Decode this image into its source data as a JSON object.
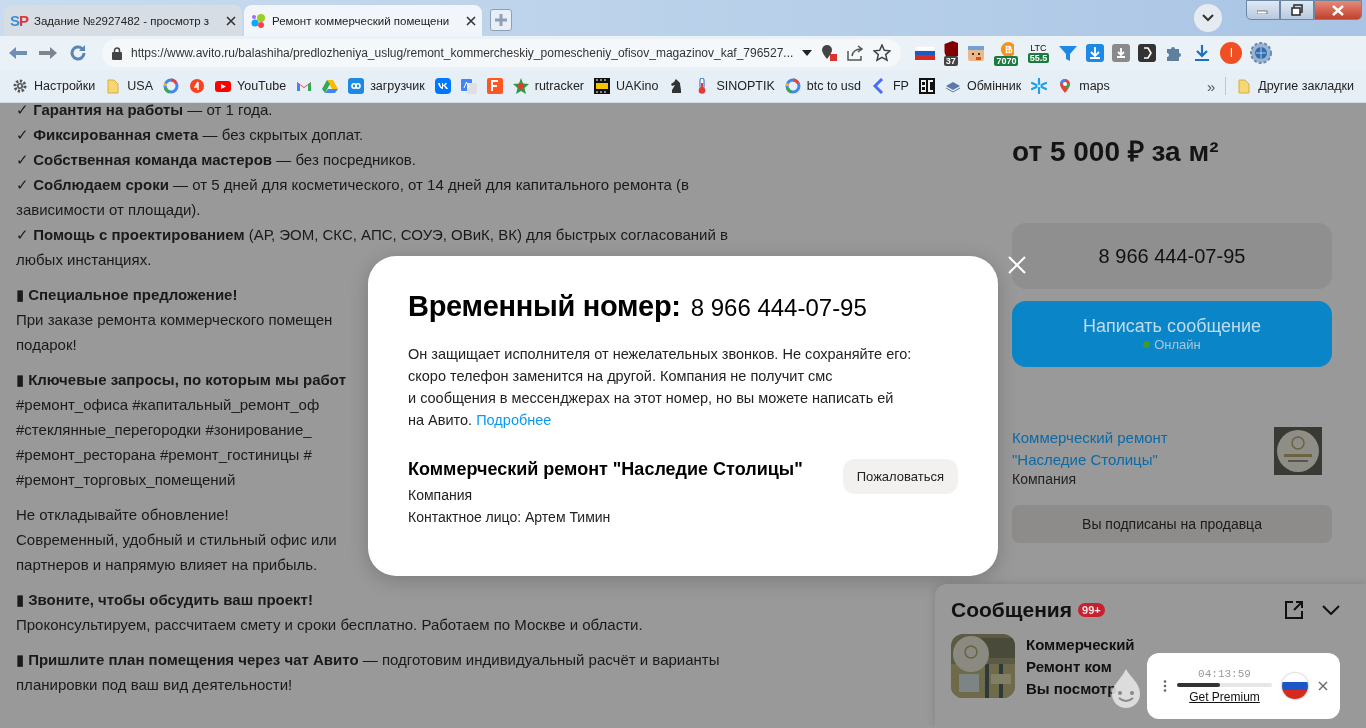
{
  "browser": {
    "tabs": [
      {
        "title": "Задание №2927482 - просмотр з",
        "kind": "sp",
        "icon_text": "SP",
        "selected": false
      },
      {
        "title": "Ремонт коммерческий помещени",
        "kind": "avito",
        "selected": true
      }
    ],
    "url": "https://www.avito.ru/balashiha/predlozheniya_uslug/remont_kommercheskiy_pomescheniy_ofisov_magazinov_kaf_796527...",
    "extensions": [
      {
        "kind": "flag"
      },
      {
        "kind": "shield",
        "badge": "37"
      },
      {
        "kind": "face"
      },
      {
        "kind": "coin",
        "badge": "7070"
      },
      {
        "kind": "ltc",
        "label": "LTC",
        "badge": "55.5"
      },
      {
        "kind": "funnel"
      },
      {
        "kind": "download-blue"
      },
      {
        "kind": "download-grey"
      },
      {
        "kind": "dark"
      },
      {
        "kind": "puzzle"
      },
      {
        "kind": "download"
      },
      {
        "kind": "profile",
        "label": "I"
      },
      {
        "kind": "globe"
      }
    ],
    "bookmarks": [
      {
        "kind": "gear",
        "label": "Настройки"
      },
      {
        "kind": "folder",
        "label": "USA"
      },
      {
        "kind": "google"
      },
      {
        "kind": "yandex"
      },
      {
        "kind": "youtube",
        "label": "YouTube"
      },
      {
        "kind": "gmail"
      },
      {
        "kind": "drive"
      },
      {
        "kind": "infinity",
        "label": "загрузчик"
      },
      {
        "kind": "vk"
      },
      {
        "kind": "translate"
      },
      {
        "kind": "f"
      },
      {
        "kind": "star",
        "label": "rutracker"
      },
      {
        "kind": "film",
        "label": "UAKino"
      },
      {
        "kind": "knight"
      },
      {
        "kind": "thermometer",
        "label": "SINOPTIK"
      },
      {
        "kind": "google",
        "label": "btc to usd"
      },
      {
        "kind": "chevron",
        "label": "FP"
      },
      {
        "kind": "bc"
      },
      {
        "kind": "layers",
        "label": "Обмінник"
      },
      {
        "kind": "asterisk"
      },
      {
        "kind": "pin",
        "label": "maps"
      }
    ],
    "more": "»",
    "other_bookmarks": "Другие закладки"
  },
  "page": {
    "description": [
      [
        "✓ **Гарантия на работы** — от 1 года.",
        "✓ **Фиксированная смета** — без скрытых доплат.",
        "✓ **Собственная команда мастеров** — без посредников.",
        "✓ **Соблюдаем сроки** — от 5 дней для косметического, от 14 дней для капитального ремонта (в",
        "зависимости от площади).",
        "✓ **Помощь с проектированием** (АР, ЭОМ, СКС, АПС, СОУЭ, ОВиК, ВК) для быстрых согласований в",
        "любых инстанциях."
      ],
      [
        "▮ **Специальное предложение!**",
        "При заказе ремонта коммерческого помещен",
        "подарок!"
      ],
      [
        "▮ **Ключевые запросы, по которым мы работ**",
        "#ремонт_офиса #капитальный_ремонт_оф",
        "#стеклянные_перегородки #зонирование_",
        "#ремонт_ресторана #ремонт_гостиницы #",
        "#ремонт_торговых_помещений"
      ],
      [
        "Не откладывайте обновление!",
        "Современный, удобный и стильный офис или",
        "партнеров и напрямую влияет на прибыль."
      ],
      [
        "▮ **Звоните, чтобы обсудить ваш проект!**",
        "Проконсультируем, рассчитаем смету и сроки бесплатно. Работаем по Москве и области."
      ],
      [
        "▮ **Пришлите план помещения через чат Авито** — подготовим индивидуальный расчёт и варианты",
        "планировки под ваш вид деятельности!"
      ]
    ],
    "price": "от 5 000 ₽ за м²",
    "phone_button": "8 966 444-07-95",
    "write_button": {
      "label": "Написать сообщение",
      "status": "Онлайн",
      "online": true
    },
    "seller": {
      "name": "Коммерческий ремонт \"Наследие Столицы\"",
      "type": "Компания"
    },
    "subscribed_button": "Вы подписаны на продавца"
  },
  "modal": {
    "title": "Временный номер:",
    "phone": "8 966 444-07-95",
    "text": "Он защищает исполнителя от нежелательных звонков. Не сохраняйте его:\nскоро телефон заменится на другой. Компания не получит смс\nи сообщения в мессенджерах на этот номер, но вы можете написать ей\nна Авито.",
    "link": "Подробнее",
    "company": "Коммерческий ремонт \"Наследие Столицы\"",
    "company_type": "Компания",
    "contact": "Контактное лицо: Артем Тимин",
    "report_button": "Пожаловаться"
  },
  "messages": {
    "title": "Сообщения",
    "badge": "99+",
    "chats": [
      {
        "lines": [
          "Коммерческий",
          "Ремонт ком",
          "Вы посмотр"
        ]
      }
    ]
  },
  "popup": {
    "time": "04:13:59",
    "level": 0.45,
    "link": "Get Premium"
  }
}
